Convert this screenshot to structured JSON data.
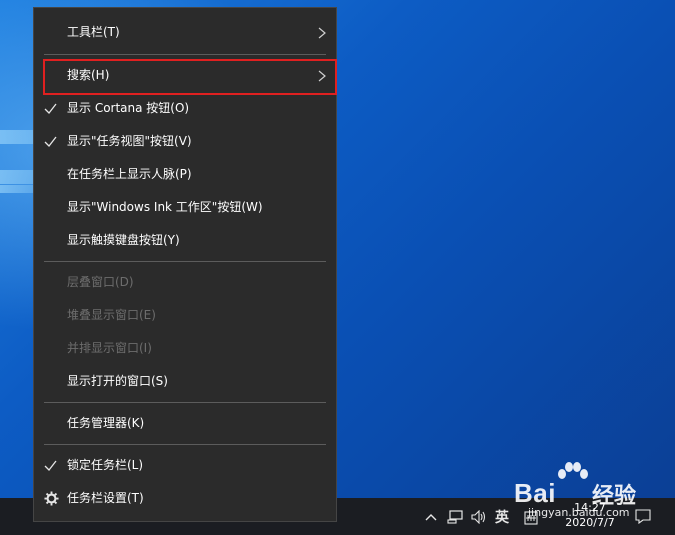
{
  "menu": {
    "items": [
      {
        "label": "工具栏(T)",
        "checked": false,
        "disabled": false,
        "submenu": true
      },
      {
        "label": "搜索(H)",
        "checked": false,
        "disabled": false,
        "submenu": true
      },
      {
        "label": "显示 Cortana 按钮(O)",
        "checked": true,
        "disabled": false,
        "submenu": false
      },
      {
        "label": "显示\"任务视图\"按钮(V)",
        "checked": true,
        "disabled": false,
        "submenu": false
      },
      {
        "label": "在任务栏上显示人脉(P)",
        "checked": false,
        "disabled": false,
        "submenu": false
      },
      {
        "label": "显示\"Windows Ink 工作区\"按钮(W)",
        "checked": false,
        "disabled": false,
        "submenu": false
      },
      {
        "label": "显示触摸键盘按钮(Y)",
        "checked": false,
        "disabled": false,
        "submenu": false
      },
      {
        "label": "层叠窗口(D)",
        "checked": false,
        "disabled": true,
        "submenu": false
      },
      {
        "label": "堆叠显示窗口(E)",
        "checked": false,
        "disabled": true,
        "submenu": false
      },
      {
        "label": "并排显示窗口(I)",
        "checked": false,
        "disabled": true,
        "submenu": false
      },
      {
        "label": "显示打开的窗口(S)",
        "checked": false,
        "disabled": false,
        "submenu": false
      },
      {
        "label": "任务管理器(K)",
        "checked": false,
        "disabled": false,
        "submenu": false
      },
      {
        "label": "锁定任务栏(L)",
        "checked": true,
        "disabled": false,
        "submenu": false
      },
      {
        "label": "任务栏设置(T)",
        "checked": false,
        "disabled": false,
        "submenu": false,
        "icon": "gear-icon"
      }
    ],
    "highlighted_item": "搜索(H)"
  },
  "taskbar": {
    "time": "14:27",
    "date": "2020/7/7",
    "ime": "英",
    "icons": [
      "chevron-up-icon",
      "network-icon",
      "volume-icon",
      "ime-icon",
      "keyboard-icon",
      "notification-icon"
    ]
  },
  "watermark": {
    "text": "Bai",
    "cn": "经验",
    "sub": "jingyan.baidu.com"
  },
  "colors": {
    "menu_bg": "#2b2b2b",
    "highlight_border": "#e02020",
    "disabled_text": "#6d6d6d",
    "taskbar_bg": "#1b1d22"
  }
}
